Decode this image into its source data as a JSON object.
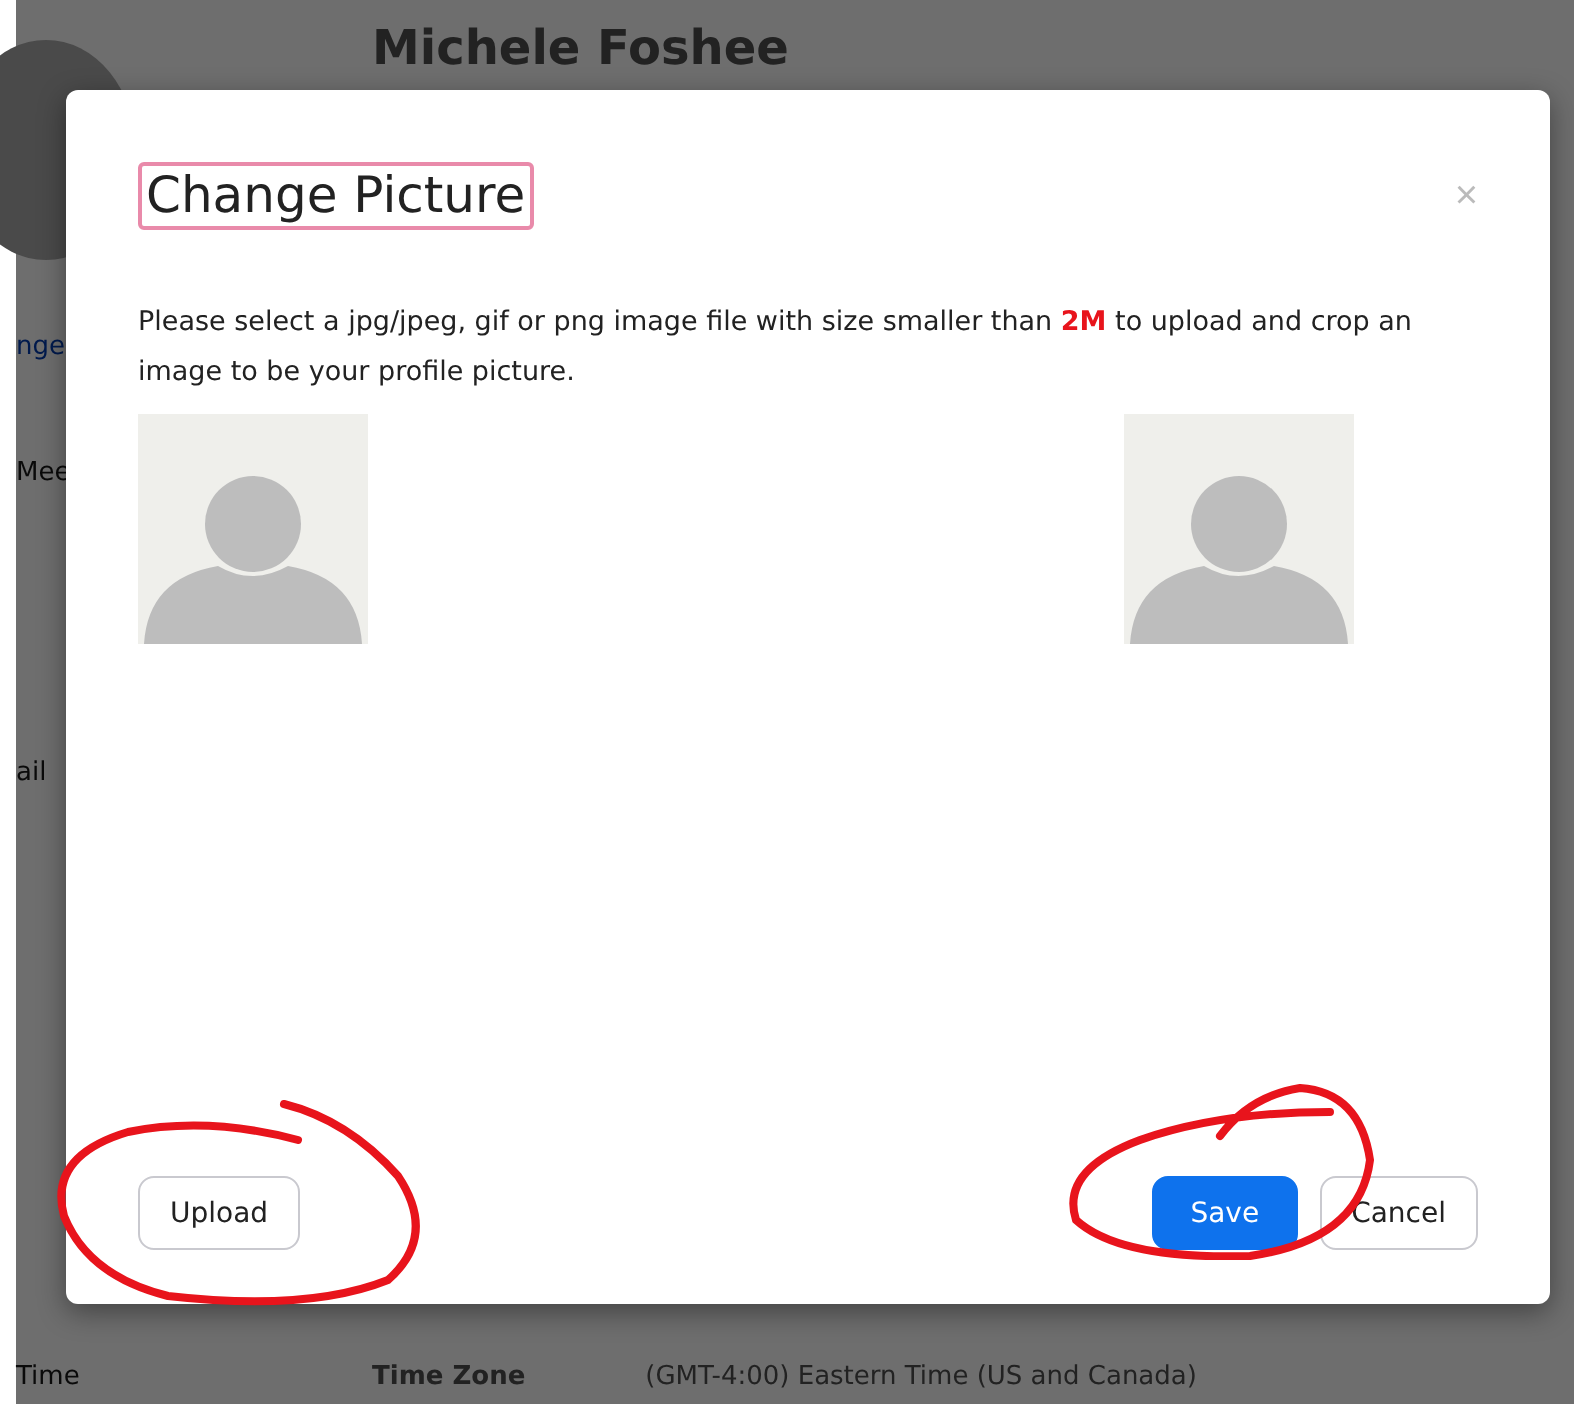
{
  "background_page": {
    "profile_name": "Michele Foshee",
    "side_labels": [
      {
        "text": "nge",
        "kind": "link"
      },
      {
        "text": "Mee",
        "kind": "label"
      },
      {
        "text": "ail",
        "kind": "label"
      },
      {
        "text": "Time",
        "kind": "label"
      }
    ],
    "time_zone": {
      "label": "Time Zone",
      "value": "(GMT-4:00) Eastern Time (US and Canada)"
    }
  },
  "dialog": {
    "title": "Change Picture",
    "close": "×",
    "message": "Please select a jpg/jpeg, gif or png image file with size smaller than **2M** to upload and crop an image to be your profile picture.",
    "buttons": [
      {
        "label": "Upload",
        "kind": "secondary"
      },
      {
        "label": "Save",
        "kind": "primary"
      },
      {
        "label": "Cancel",
        "kind": "secondary"
      }
    ]
  }
}
